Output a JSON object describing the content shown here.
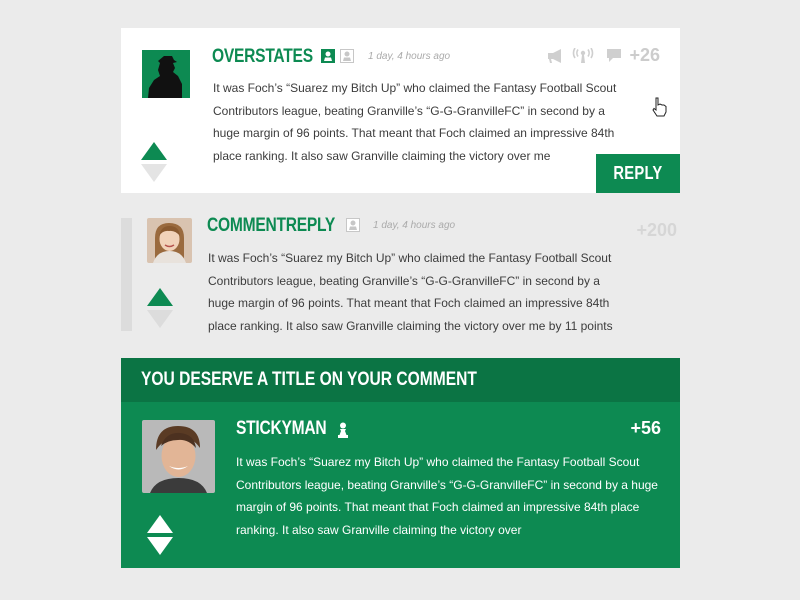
{
  "comments": [
    {
      "username": "OVERSTATES",
      "timestamp": "1 day, 4 hours ago",
      "score": "+26",
      "text": "It was Foch’s “Suarez my Bitch Up” who claimed the Fantasy Football Scout Contributors league, beating Granville’s “G-G-GranvilleFC” in second by a huge margin of 96 points. That meant that Foch claimed an impressive 84th place ranking. It also saw Granville claiming the victory over me",
      "reply_label": "REPLY"
    },
    {
      "username": "COMMENTREPLY",
      "timestamp": "1 day, 4 hours ago",
      "score": "+200",
      "text": "It was Foch’s “Suarez my Bitch Up” who claimed the Fantasy Football Scout Contributors league, beating Granville’s “G-G-GranvilleFC” in second by a huge margin of 96 points. That meant that Foch claimed an impressive 84th place ranking. It also saw Granville claiming the victory over me by 11 points"
    },
    {
      "section_title": "YOU DESERVE A TITLE ON YOUR COMMENT",
      "username": "STICKYMAN",
      "score": "+56",
      "text": "It was Foch’s “Suarez my Bitch Up” who claimed the Fantasy Football Scout Contributors league, beating Granville’s “G-G-GranvilleFC” in second by a huge margin of 96 points. That meant that Foch claimed an impressive 84th place ranking. It also saw Granville claiming the victory over"
    }
  ],
  "icons": {
    "badge_green": "user-badge-icon",
    "badge_gray": "user-badge-outline-icon",
    "megaphone": "megaphone-icon",
    "broadcast": "broadcast-icon",
    "chat": "speech-bubble-icon",
    "cursor": "hand-pointer-icon",
    "chess": "chess-pawn-icon"
  },
  "colors": {
    "accent": "#0d8a52",
    "accent_dark": "#0b7444",
    "muted": "#cccccc",
    "background": "#ebebeb"
  }
}
